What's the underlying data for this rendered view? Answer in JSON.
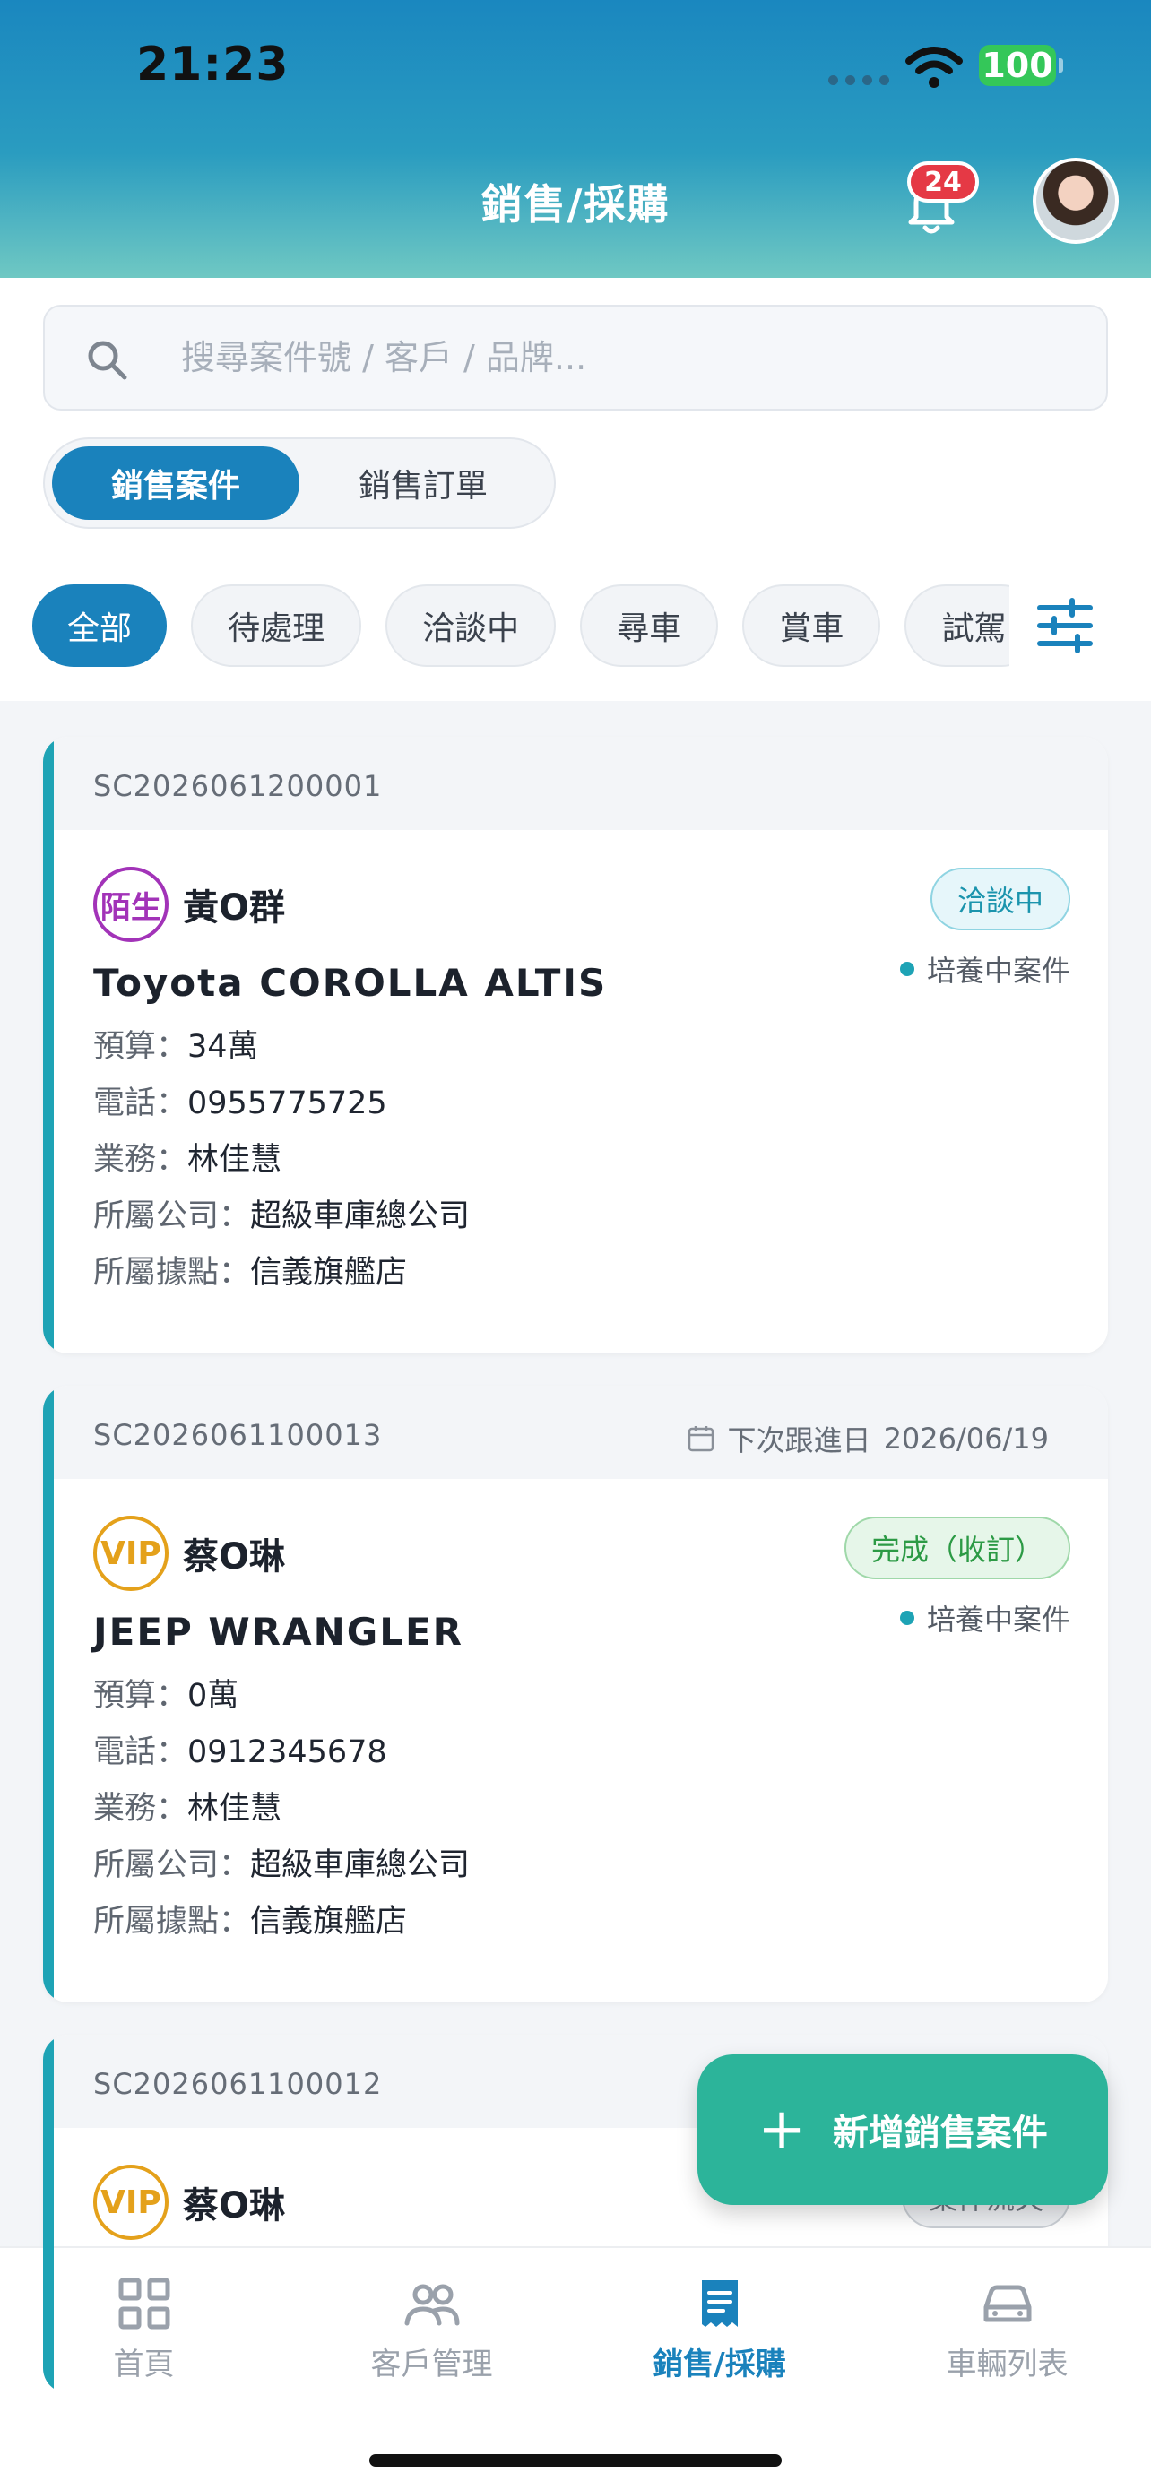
{
  "status_bar": {
    "time": "21:23",
    "battery": "100"
  },
  "header": {
    "title": "銷售/採購",
    "notification_count": "24"
  },
  "search": {
    "placeholder": "搜尋案件號 / 客戶 / 品牌..."
  },
  "segments": {
    "active": "銷售案件",
    "inactive": "銷售訂單"
  },
  "chips": [
    "全部",
    "待處理",
    "洽談中",
    "尋車",
    "賞車",
    "試駕"
  ],
  "labels": {
    "budget": "預算：",
    "phone": "電話：",
    "sales": "業務：",
    "company": "所屬公司：",
    "branch": "所屬據點：",
    "follow_prefix": "下次跟進日"
  },
  "cards": [
    {
      "case_no": "SC2026061200001",
      "tag": "陌生",
      "customer": "黃O群",
      "status": "洽談中",
      "nurture": "培養中案件",
      "car": "Toyota COROLLA ALTIS",
      "budget": "34萬",
      "phone": "0955775725",
      "sales": "林佳慧",
      "company": "超級車庫總公司",
      "branch": "信義旗艦店"
    },
    {
      "case_no": "SC2026061100013",
      "follow_date": "2026/06/19",
      "tag": "VIP",
      "customer": "蔡O琳",
      "status": "完成（收訂）",
      "nurture": "培養中案件",
      "car": "JEEP WRANGLER",
      "budget": "0萬",
      "phone": "0912345678",
      "sales": "林佳慧",
      "company": "超級車庫總公司",
      "branch": "信義旗艦店"
    },
    {
      "case_no": "SC2026061100012",
      "tag": "VIP",
      "customer": "蔡O琳",
      "status": "案件流失"
    }
  ],
  "fab": {
    "label": "新增銷售案件"
  },
  "tabbar": [
    {
      "label": "首頁",
      "icon": "grid-icon"
    },
    {
      "label": "客戶管理",
      "icon": "people-icon"
    },
    {
      "label": "銷售/採購",
      "icon": "receipt-icon",
      "active": true
    },
    {
      "label": "車輛列表",
      "icon": "car-icon"
    }
  ],
  "colors": {
    "primary": "#1a82bc",
    "accent": "#2cb49a",
    "card_bar": "#1ea3b5",
    "badge": "#e53945"
  }
}
